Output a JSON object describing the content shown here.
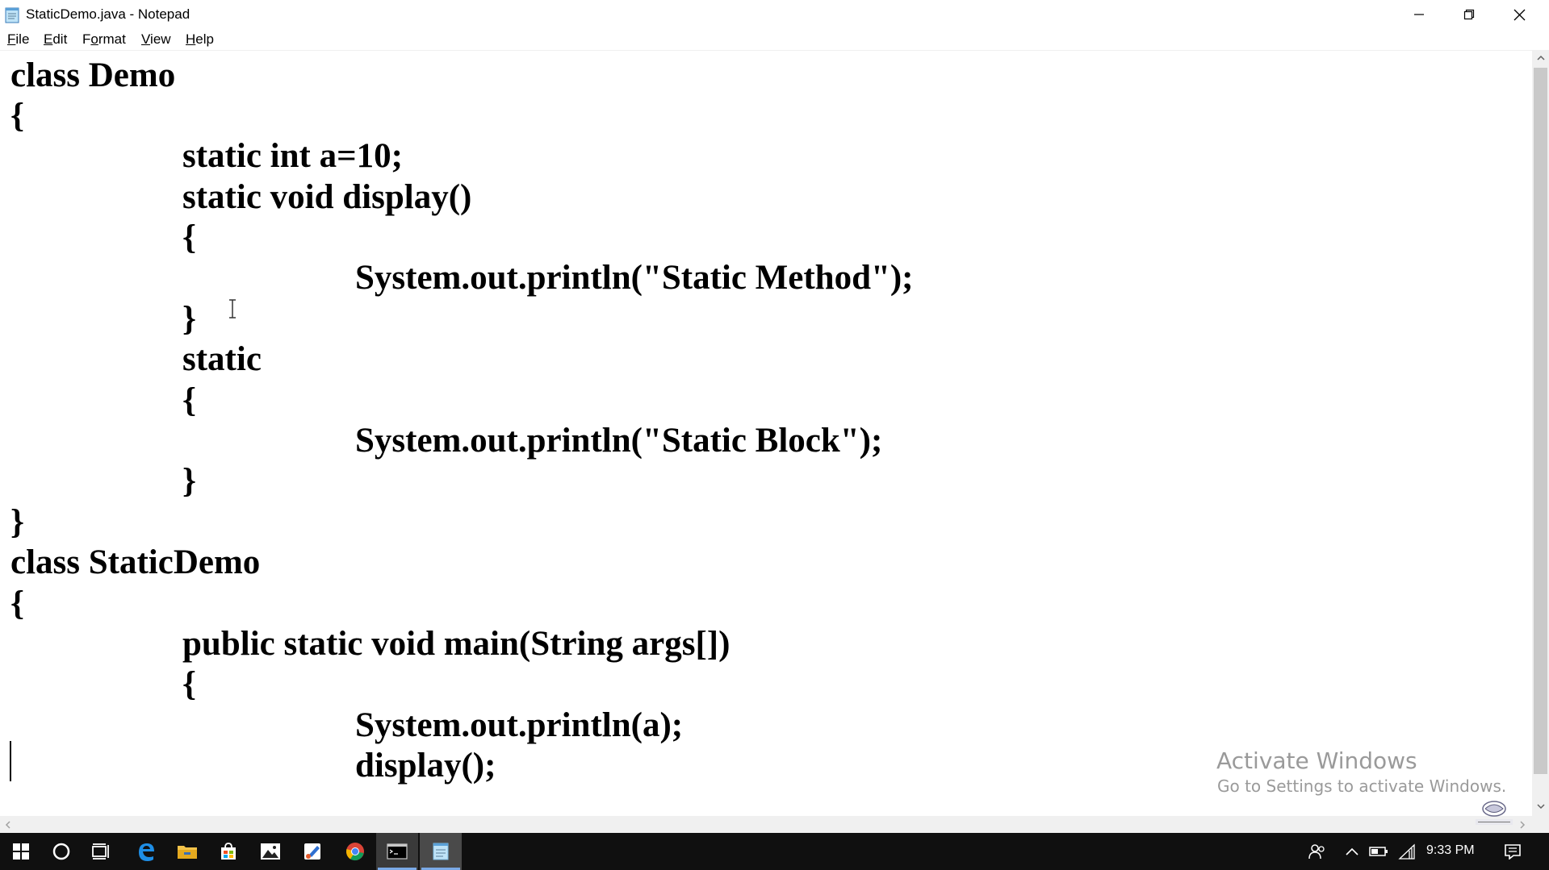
{
  "window": {
    "title": "StaticDemo.java - Notepad",
    "icon": "notepad-icon",
    "controls": [
      "minimize-icon",
      "restore-icon",
      "close-icon"
    ]
  },
  "menu": {
    "file": {
      "access": "F",
      "rest": "ile"
    },
    "edit": {
      "access": "E",
      "rest": "dit"
    },
    "format": {
      "access": "o",
      "pre": "F",
      "rest": "rmat"
    },
    "view": {
      "access": "V",
      "rest": "iew"
    },
    "help": {
      "access": "H",
      "rest": "elp"
    }
  },
  "editor": {
    "lines": [
      "class Demo",
      "{",
      "static int a=10;",
      "static void display()",
      "{",
      "System.out.println(\"Static Method\");",
      "}",
      "static",
      "{",
      "System.out.println(\"Static Block\");",
      "}",
      "}",
      "class StaticDemo",
      "{",
      "public static void main(String args[])",
      "{",
      "System.out.println(a);",
      "display();"
    ]
  },
  "watermark": {
    "title": "Activate Windows",
    "subtitle": "Go to Settings to activate Windows."
  },
  "taskbar": {
    "apps": [
      "windows-start-icon",
      "cortana-search-icon",
      "task-view-icon",
      "edge-browser-icon",
      "file-explorer-icon",
      "store-icon",
      "photos-icon",
      "paint-icon",
      "chrome-icon",
      "command-prompt-icon",
      "notepad-icon"
    ],
    "active_app": "notepad-icon",
    "tray": [
      "people-icon",
      "show-hidden-icons-chevron",
      "battery-icon",
      "wifi-icon",
      "action-center-icon"
    ],
    "clock": "9:33 PM"
  },
  "colors": {
    "taskbar_bg": "#101010",
    "active_indicator": "#7aa9e6",
    "watermark_text": "#9a9a9a"
  }
}
